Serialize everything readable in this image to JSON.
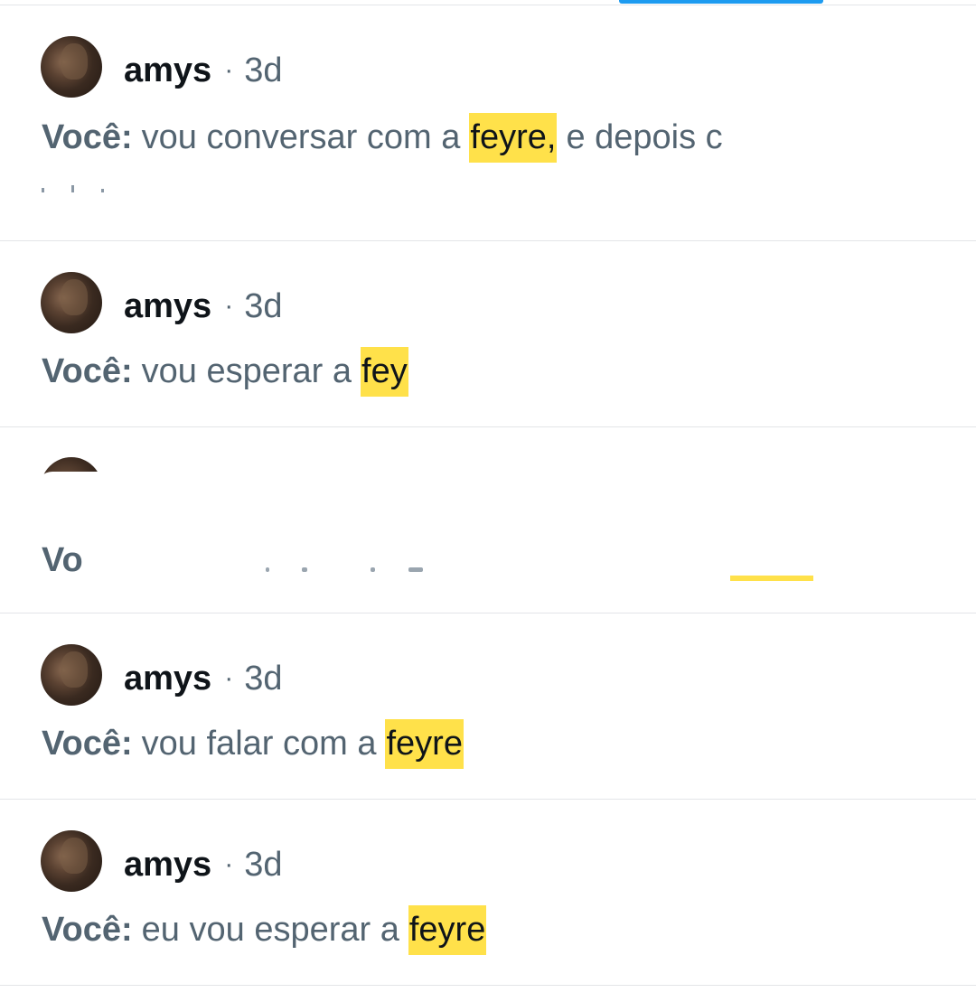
{
  "colors": {
    "accent": "#1d9bf0",
    "highlight": "#ffe14a",
    "name_text": "#0f1419",
    "secondary_text": "#536471",
    "divider": "#e3e5e8"
  },
  "results": [
    {
      "name": "amys",
      "separator": "·",
      "time": "3d",
      "sender": "Você:",
      "before": "vou conversar com a",
      "highlight": "feyre,",
      "after": "e depois c"
    },
    {
      "name": "amys",
      "separator": "·",
      "time": "3d",
      "sender": "Você:",
      "before": "vou esperar a",
      "highlight": "fey",
      "after": ""
    },
    {
      "sender": "Vo"
    },
    {
      "name": "amys",
      "separator": "·",
      "time": "3d",
      "sender": "Você:",
      "before": "vou falar com a",
      "highlight": "feyre",
      "after": ""
    },
    {
      "name": "amys",
      "separator": "·",
      "time": "3d",
      "sender": "Você:",
      "before": "eu vou esperar a",
      "highlight": "feyre",
      "after": ""
    }
  ]
}
